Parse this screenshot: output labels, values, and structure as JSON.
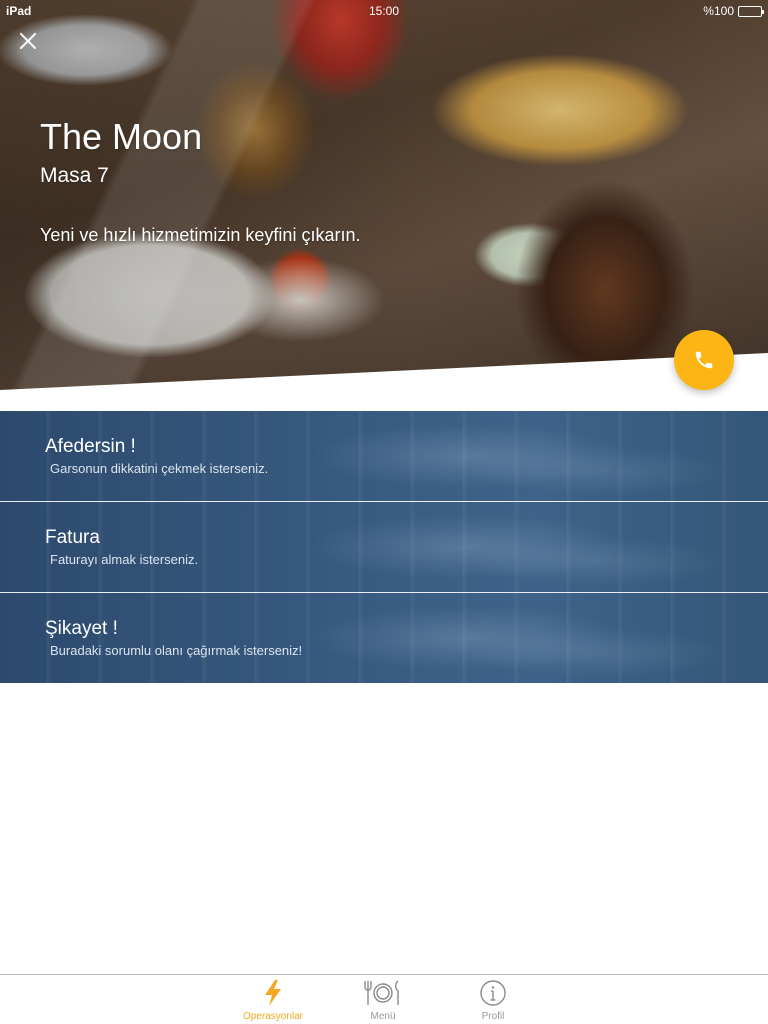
{
  "status_bar": {
    "device": "iPad",
    "time": "15:00",
    "battery": "%100"
  },
  "hero": {
    "title": "The Moon",
    "table": "Masa 7",
    "tagline": "Yeni ve hızlı hizmetimizin keyfini çıkarın."
  },
  "operations": [
    {
      "title": "Afedersin !",
      "subtitle": "Garsonun dikkatini çekmek isterseniz."
    },
    {
      "title": "Fatura",
      "subtitle": "Faturayı almak isterseniz."
    },
    {
      "title": "Şikayet !",
      "subtitle": "Buradaki sorumlu olanı çağırmak isterseniz!"
    }
  ],
  "tabbar": {
    "items": [
      {
        "label": "Operasyonlar",
        "icon": "lightning-icon",
        "active": true
      },
      {
        "label": "Menü",
        "icon": "cutlery-plate-icon",
        "active": false
      },
      {
        "label": "Profil",
        "icon": "info-icon",
        "active": false
      }
    ]
  },
  "colors": {
    "accent": "#fdb515",
    "tab_active": "#f5a623",
    "row_blue": "#385a80",
    "tab_inactive": "#9a9a9a"
  }
}
